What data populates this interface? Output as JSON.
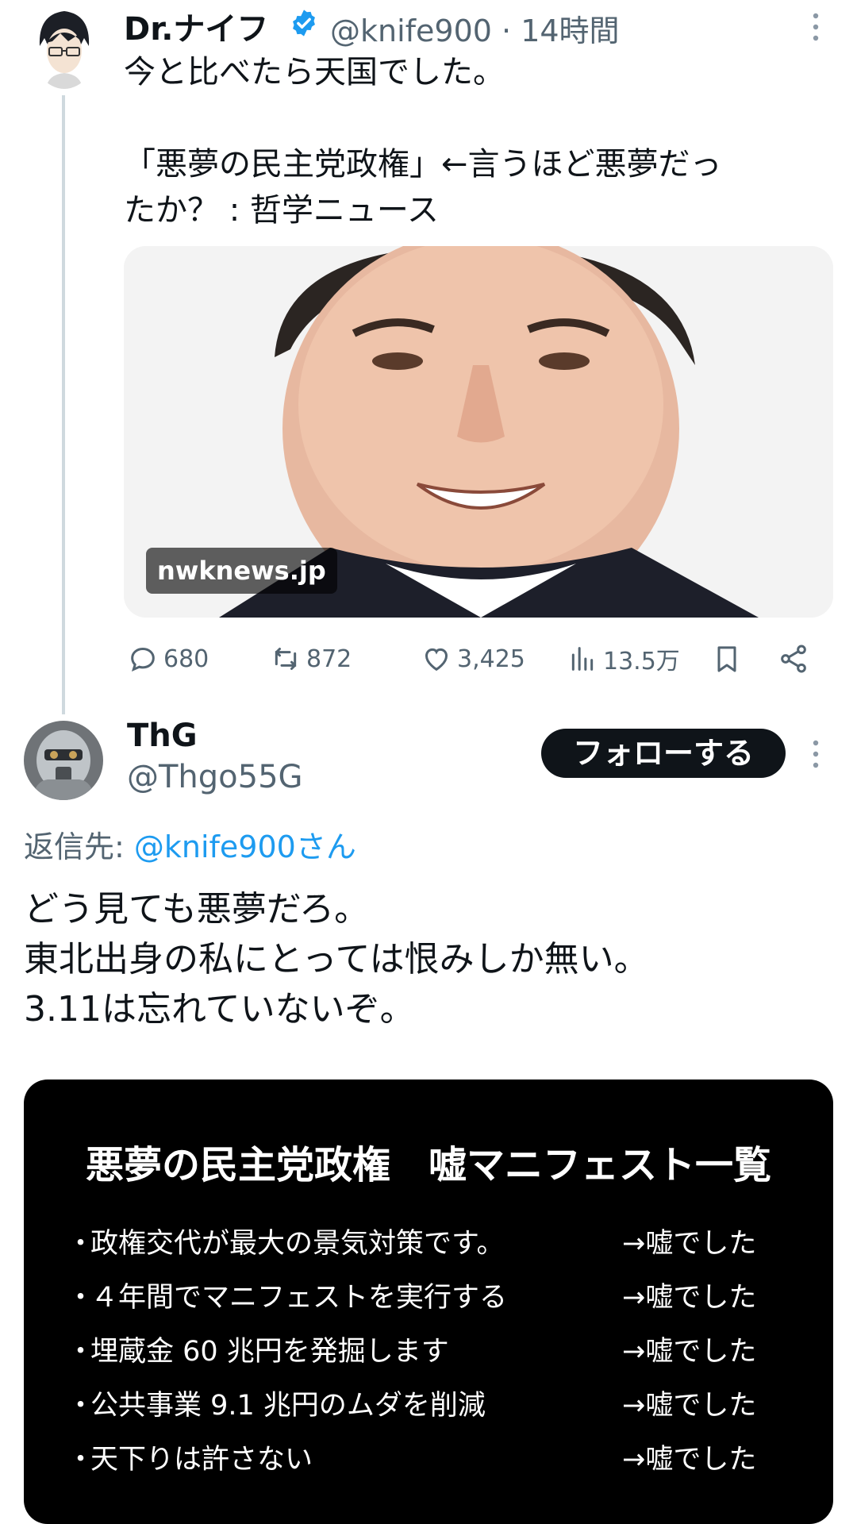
{
  "tweet": {
    "author_name": "Dr.ナイフ",
    "handle": "@knife900",
    "time": "· 14時間",
    "text_line1": "今と比べたら天国でした。",
    "text_line2": "「悪夢の民主党政権」←言うほど悪夢だっ",
    "text_line3": "たか？ : 哲学ニュース",
    "card_domain": "nwknews.jp",
    "replies": "680",
    "retweets": "872",
    "likes": "3,425",
    "views": "13.5万"
  },
  "reply": {
    "author_name": "ThG",
    "handle": "@Thgo55G",
    "follow_label": "フォローする",
    "reply_to_label": "返信先:",
    "reply_to_user": "@knife900さん",
    "text_line1": "どう見ても悪夢だろ。",
    "text_line2": "東北出身の私にとっては恨みしか無い。",
    "text_line3": "3.11は忘れていないぞ。",
    "image": {
      "title": "悪夢の民主党政権　嘘マニフェスト一覧",
      "rows": [
        {
          "bullet": "・",
          "text": "政権交代が最大の景気対策です。",
          "result": "→嘘でした"
        },
        {
          "bullet": "・",
          "text": "４年間でマニフェストを実行する",
          "result": "→嘘でした"
        },
        {
          "bullet": "・",
          "text": "埋蔵金 60 兆円を発掘します",
          "result": "→嘘でした"
        },
        {
          "bullet": "・",
          "text": "公共事業 9.1 兆円のムダを削減",
          "result": "→嘘でした"
        },
        {
          "bullet": "・",
          "text": "天下りは許さない",
          "result": "→嘘でした"
        }
      ]
    }
  },
  "colors": {
    "text": "#0f1419",
    "secondary": "#536471",
    "link": "#1d9bf0",
    "verified": "#1d9bf0",
    "follow_bg": "#0f1419"
  }
}
